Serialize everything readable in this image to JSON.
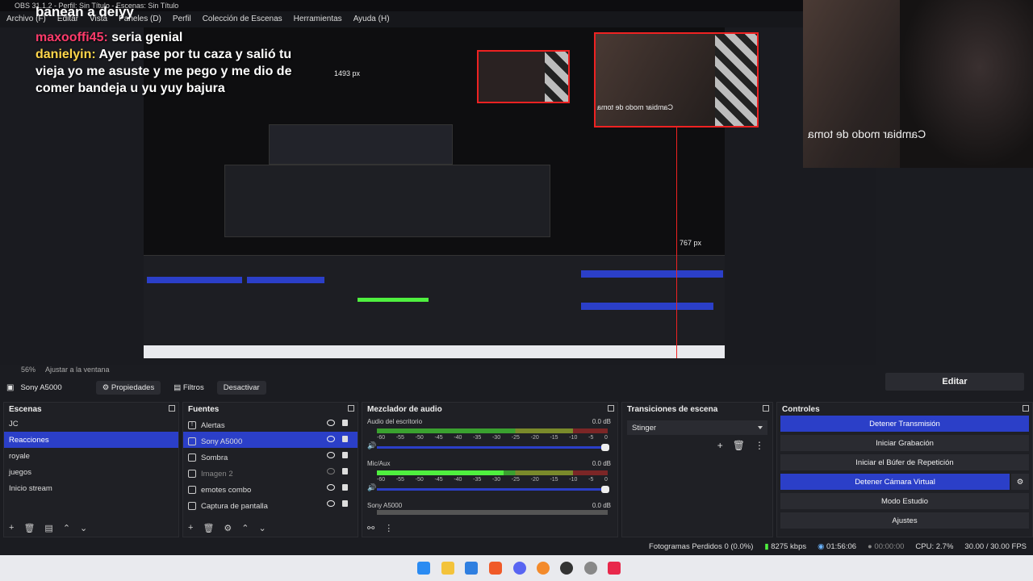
{
  "window": {
    "title": "OBS 31.1.2 - Perfil: Sin Título - Escenas: Sin Título"
  },
  "menu": [
    "Archivo (F)",
    "Editar",
    "Vista",
    "Paneles (D)",
    "Perfil",
    "Colección de Escenas",
    "Herramientas",
    "Ayuda (H)"
  ],
  "overlay": {
    "banner": "banean a deiyy",
    "chat": [
      {
        "user": "maxooffi45:",
        "message": "seria genial"
      },
      {
        "user": "danielyin:",
        "message": "Ayer pase por tu caza y salió tu vieja yo me asuste y me pego y me dio de comer bandeja u yu yuy bajura"
      }
    ],
    "camera_text": "Cambiar modo de toma",
    "inner_camera_text": "Cambiar modo de toma",
    "px_label_1": "1493 px",
    "px_label_2": "767 px"
  },
  "zoom": {
    "level": "56%",
    "fit": "Ajustar a la ventana"
  },
  "right_panel": {
    "edit_label": "Editar"
  },
  "source_toolbar": {
    "source_name": "Sony A5000",
    "properties": "Propiedades",
    "filters": "Filtros",
    "deactivate": "Desactivar"
  },
  "scenes": {
    "title": "Escenas",
    "items": [
      "JC",
      "Reacciones",
      "royale",
      "juegos",
      "Inicio stream"
    ],
    "selected": 1
  },
  "sources": {
    "title": "Fuentes",
    "items": [
      "Alertas",
      "Sony A5000",
      "Sombra",
      "Imagen 2",
      "emotes combo",
      "Captura de pantalla"
    ]
  },
  "mixer": {
    "title": "Mezclador de audio",
    "channels": [
      {
        "name": "Audio del escritorio",
        "db": "0.0 dB",
        "level": 0.0
      },
      {
        "name": "Mic/Aux",
        "db": "0.0 dB",
        "level": 0.55
      },
      {
        "name": "Sony A5000",
        "db": "0.0 dB",
        "level": 0.0
      }
    ],
    "ticks": [
      "-60",
      "-55",
      "-50",
      "-45",
      "-40",
      "-35",
      "-30",
      "-25",
      "-20",
      "-15",
      "-10",
      "-5",
      "0"
    ]
  },
  "transitions": {
    "title": "Transiciones de escena",
    "selected": "Stinger"
  },
  "controls": {
    "title": "Controles",
    "buttons": [
      {
        "label": "Detener Transmisión",
        "active": true
      },
      {
        "label": "Iniciar Grabación",
        "active": false
      },
      {
        "label": "Iniciar el Búfer de Repetición",
        "active": false
      },
      {
        "label": "Detener Cámara Virtual",
        "active": true
      },
      {
        "label": "Modo Estudio",
        "active": false
      },
      {
        "label": "Ajustes",
        "active": false
      }
    ]
  },
  "status": {
    "dropped": "Fotogramas Perdidos 0 (0.0%)",
    "bitrate": "8275 kbps",
    "live_time": "01:56:06",
    "rec_time": "00:00:00",
    "cpu": "CPU: 2.7%",
    "fps": "30.00 / 30.00 FPS"
  },
  "colors": {
    "accent": "#2b3fc8",
    "recording_red": "#e22222"
  }
}
